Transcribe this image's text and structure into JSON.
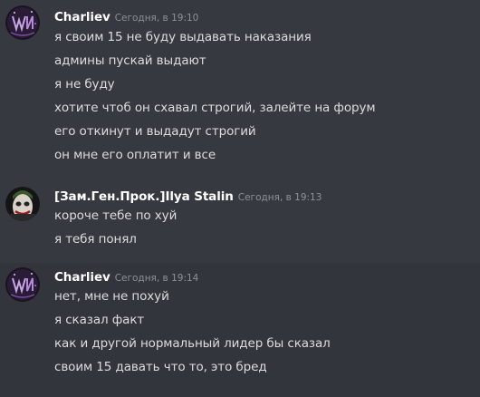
{
  "messages": [
    {
      "author": "Charliev",
      "timestamp": "Сегодня, в 19:10",
      "lines": [
        "я своим 15 не буду выдавать наказания",
        "админы пускай выдают",
        "я не буду",
        "хотите чтоб он схавал строгий, залейте на форум",
        "его откинут и выдадут строгий",
        "он мне его оплатит и все"
      ]
    },
    {
      "author": "[Зам.Ген.Прок.]Ilya Stalin",
      "timestamp": "Сегодня, в 19:13",
      "lines": [
        "короче тебе по хуй",
        "я тебя понял"
      ]
    },
    {
      "author": "Charliev",
      "timestamp": "Сегодня, в 19:14",
      "lines": [
        "нет, мне не похуй",
        "я сказал факт",
        "как и другой нормальный лидер бы сказал",
        "своим 15 давать что то, это бред"
      ]
    }
  ],
  "colors": {
    "background": "#36393f",
    "hover_background": "#32353b",
    "username": "#ffffff",
    "message_text": "#dcddde",
    "timestamp": "#8e9297"
  },
  "icons": {
    "charliev_avatar": "charliev-avatar-icon",
    "stalin_avatar": "joker-avatar-icon"
  }
}
